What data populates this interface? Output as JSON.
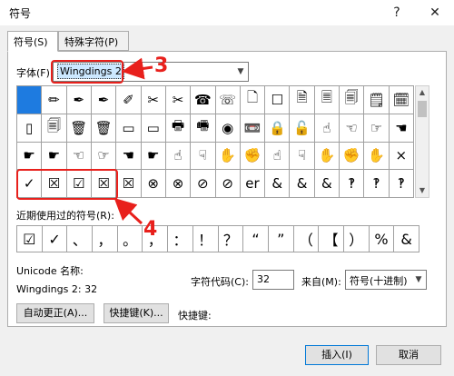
{
  "dialog": {
    "title": "符号",
    "help_glyph": "?",
    "close_glyph": "✕"
  },
  "tabs": [
    {
      "label": "符号(S)"
    },
    {
      "label": "特殊字符(P)"
    }
  ],
  "font": {
    "label": "字体(F):",
    "value": "Wingdings 2"
  },
  "symbols": [
    [
      "",
      "✏",
      "✒",
      "✒",
      "✐",
      "✂",
      "✂",
      "☎",
      "☏",
      "🗋",
      "☐",
      "🗎",
      "🗏",
      "🗐",
      "🗒",
      "🗓"
    ],
    [
      "▯",
      "🗐",
      "🗑",
      "🗑",
      "▭",
      "▭",
      "🖶",
      "🖷",
      "◉",
      "📼",
      "🔒",
      "🔓",
      "☝",
      "☜",
      "☞",
      "☚"
    ],
    [
      "☛",
      "☛",
      "☜",
      "☞",
      "☚",
      "☛",
      "☝",
      "☟",
      "✋",
      "✊",
      "☝",
      "☟",
      "✋",
      "✊",
      "✋",
      "×"
    ],
    [
      "✓",
      "☒",
      "☑",
      "☒",
      "☒",
      "⊗",
      "⊗",
      "⊘",
      "⊘",
      "er",
      "&",
      "&",
      "&",
      "‽",
      "‽",
      "‽"
    ]
  ],
  "recent": {
    "label": "近期使用过的符号(R):",
    "items": [
      "☑",
      "✓",
      "、",
      "，",
      "。",
      "，",
      "：",
      "！",
      "？",
      "“",
      "”",
      "（",
      "【",
      "）",
      "%",
      "&"
    ]
  },
  "unicode": {
    "name_label": "Unicode 名称:",
    "name_value": "Wingdings 2: 32",
    "code_label": "字符代码(C):",
    "code_value": "32",
    "from_label": "来自(M):",
    "from_value": "符号(十进制)"
  },
  "buttons": {
    "autocorrect": "自动更正(A)...",
    "shortcut_key": "快捷键(K)...",
    "shortcut_label": "快捷键:",
    "insert": "插入(I)",
    "cancel": "取消"
  },
  "annotations": {
    "three": "3",
    "four": "4"
  },
  "colors": {
    "annotation": "#e8201c",
    "selection": "#1e7be0"
  }
}
